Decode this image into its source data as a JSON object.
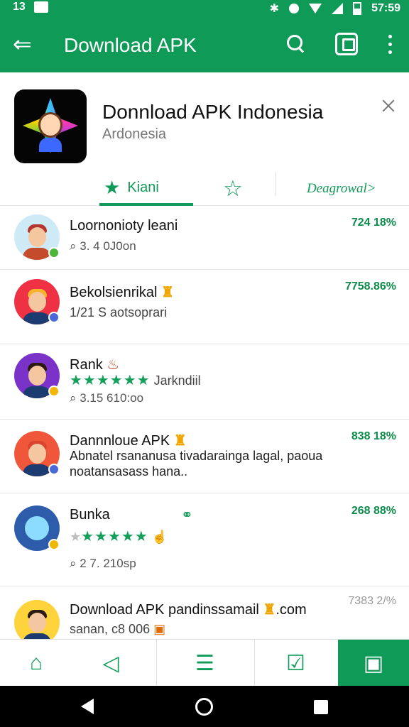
{
  "status": {
    "time_left": "13",
    "time_right": "57:59"
  },
  "toolbar": {
    "title": "Download APK"
  },
  "app": {
    "name": "Donnload APK Indonesia",
    "developer": "Ardonesia"
  },
  "tabs": [
    {
      "label": "Kiani"
    },
    {
      "label": ""
    },
    {
      "label": "Deagrowal>"
    }
  ],
  "items": [
    {
      "name": "Loornonioty leani",
      "meta": "3. 4 0J0on",
      "percentage": "724 18%"
    },
    {
      "name": "Bekolsienrikal",
      "meta": "1/21 S aotsoprari",
      "percentage": "7758.86%"
    },
    {
      "name": "Rank",
      "stars": "★★★★★★",
      "rating_text": "Jarkndiil",
      "meta": "3.15 610:oo",
      "percentage": ""
    },
    {
      "name": "Dannnloue APK",
      "description": "Abnatel rsananusa tivadarainga lagal, paoua noatansasass hana..",
      "percentage": "838 18%"
    },
    {
      "name": "Bunka",
      "stars": "★★★★★",
      "meta": "2 7. 210sp",
      "percentage": "268 88%"
    },
    {
      "name": "Download APK pandinssamail",
      "domain": ".com",
      "meta": "sanan, c8 006",
      "percentage": "7383 2/%"
    }
  ]
}
